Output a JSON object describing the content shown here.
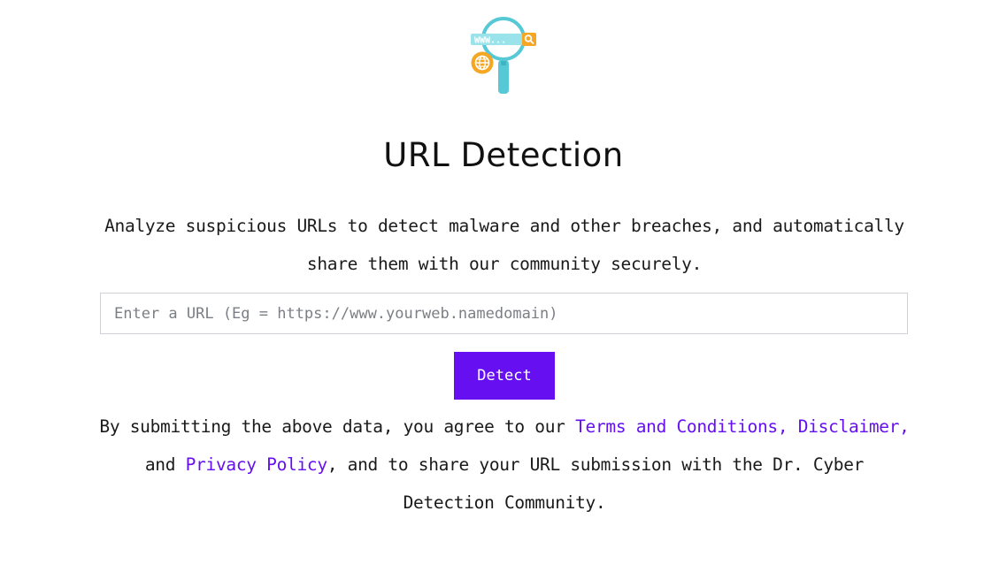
{
  "logo": {
    "icon": "url-search-magnifier-icon",
    "address_text": "WWW...",
    "colors": {
      "teal": "#56c8d6",
      "orange": "#f5a623",
      "light_teal": "#9be3ea"
    }
  },
  "header": {
    "title": "URL Detection"
  },
  "description": "Analyze suspicious URLs to detect malware and other breaches, and automatically share them with our community securely.",
  "search": {
    "placeholder": "Enter a URL (Eg = https://www.yourweb.namedomain)",
    "value": ""
  },
  "detect_button": {
    "label": "Detect",
    "color": "#6610f2"
  },
  "disclaimer": {
    "text_before": "By submitting the above data, you agree to our ",
    "terms_link": "Terms and Conditions,",
    "disclaimer_link": "Disclaimer,",
    "text_and": "and ",
    "privacy_link": "Privacy Policy",
    "text_after": ", and to share your URL submission with the Dr. Cyber Detection Community.",
    "link_color": "#6610f2"
  }
}
